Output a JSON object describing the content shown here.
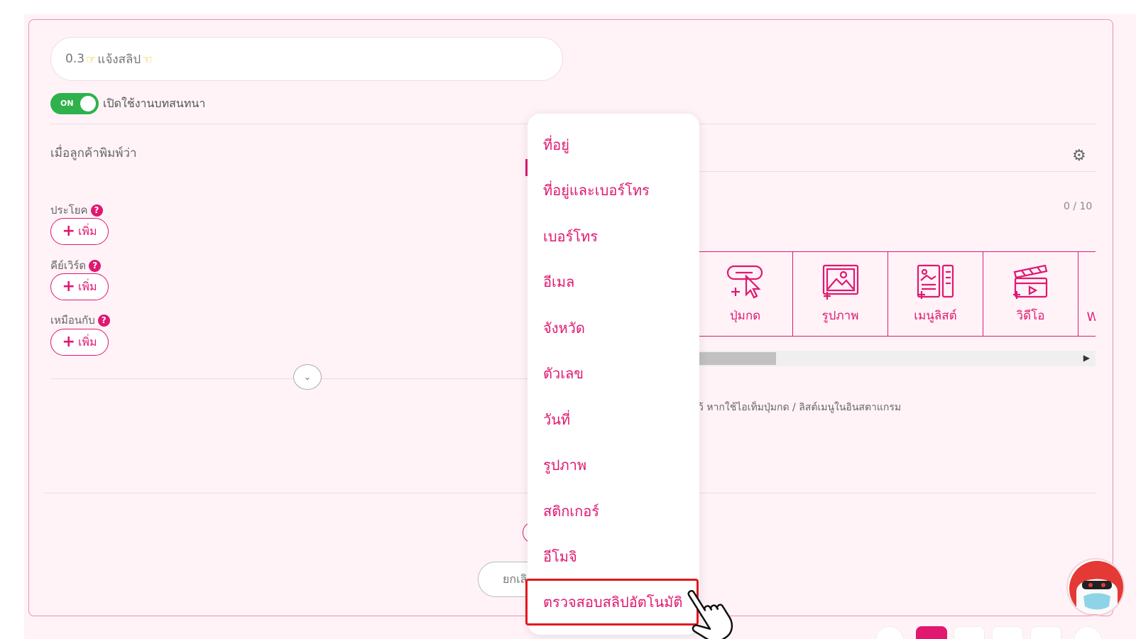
{
  "intent": {
    "title_value": "0.3 👉แจ้งสลิป👈",
    "title_parts": {
      "number": "0.3",
      "text": "แจ้งสลิป"
    },
    "toggle": {
      "state": "ON",
      "label": "เปิดใช้งานบทสนทนา"
    }
  },
  "customer_says": {
    "heading": "เมื่อลูกค้าพิมพ์ว่า",
    "sections": [
      {
        "label": "ประโยค",
        "add_label": "เพิ่ม"
      },
      {
        "label": "คีย์เวิร์ด",
        "add_label": "เพิ่ม"
      },
      {
        "label": "เหมือนกับ",
        "add_label": "เพิ่ม"
      }
    ],
    "help_glyph": "?"
  },
  "response": {
    "counter": "0 / 10",
    "tiles": [
      {
        "label": "ปุ่มกด",
        "icon": "button-cursor-icon"
      },
      {
        "label": "รูปภาพ",
        "icon": "image-icon"
      },
      {
        "label": "เมนูลิสต์",
        "icon": "menu-list-icon"
      },
      {
        "label": "วิดีโอ",
        "icon": "video-clapper-icon"
      }
    ],
    "partial_tile_label": "W",
    "hint": "ว้ หากใช้ไอเท็มปุ่มกด / ลิสต์เมนูในอินสตาแกรม"
  },
  "footer": {
    "cancel_label": "ยกเลิ"
  },
  "dropdown": {
    "items": [
      "ที่อยู่",
      "ที่อยู่และเบอร์โทร",
      "เบอร์โทร",
      "อีเมล",
      "จังหวัด",
      "ตัวเลข",
      "วันที่",
      "รูปภาพ",
      "สติกเกอร์",
      "อีโมจิ",
      "ตรวจสอบสลิปอัตโนมัติ"
    ],
    "selected_index": 10
  },
  "colors": {
    "accent": "#e01870",
    "toggle_on": "#2fb24c",
    "highlight": "#e5161b",
    "panel_bg": "#fff3f8"
  }
}
